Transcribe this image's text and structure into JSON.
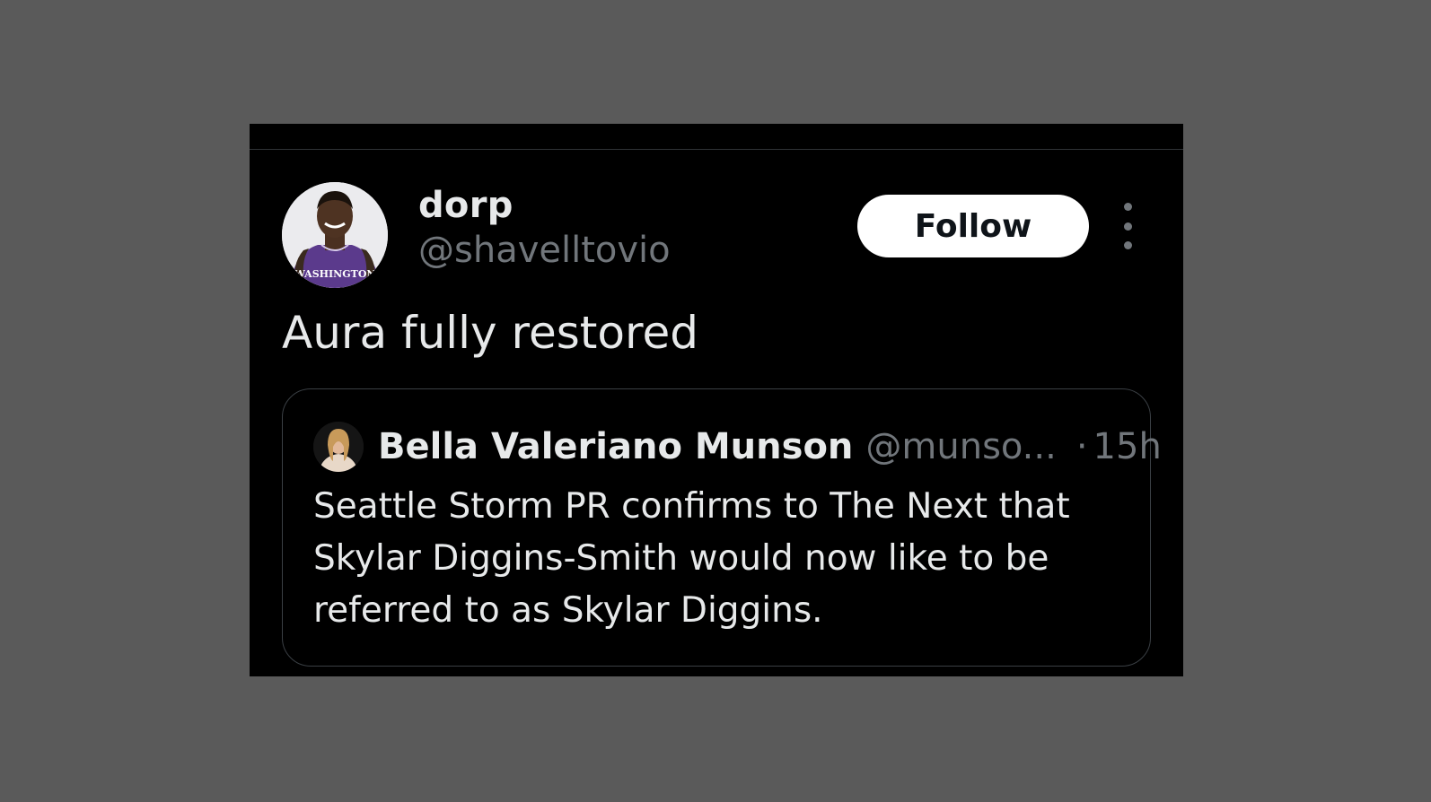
{
  "tweet": {
    "author": {
      "display_name": "dorp",
      "handle": "@shavelltovio",
      "avatar_icon": "player-avatar",
      "jersey_text": "WASHINGTON"
    },
    "follow_label": "Follow",
    "more_icon": "more-vertical-icon",
    "text": "Aura fully restored"
  },
  "quote": {
    "avatar_icon": "user-avatar",
    "display_name": "Bella Valeriano Munson",
    "handle": "@munso...",
    "separator": "·",
    "time": "15h",
    "text": "Seattle Storm PR confirms to The Next that Skylar Diggins-Smith would now like to be referred to as Skylar Diggins."
  },
  "colors": {
    "background": "#5a5a5a",
    "card": "#000000",
    "primary_text": "#e7e9ea",
    "secondary_text": "#71767b",
    "follow_bg": "#ffffff"
  }
}
